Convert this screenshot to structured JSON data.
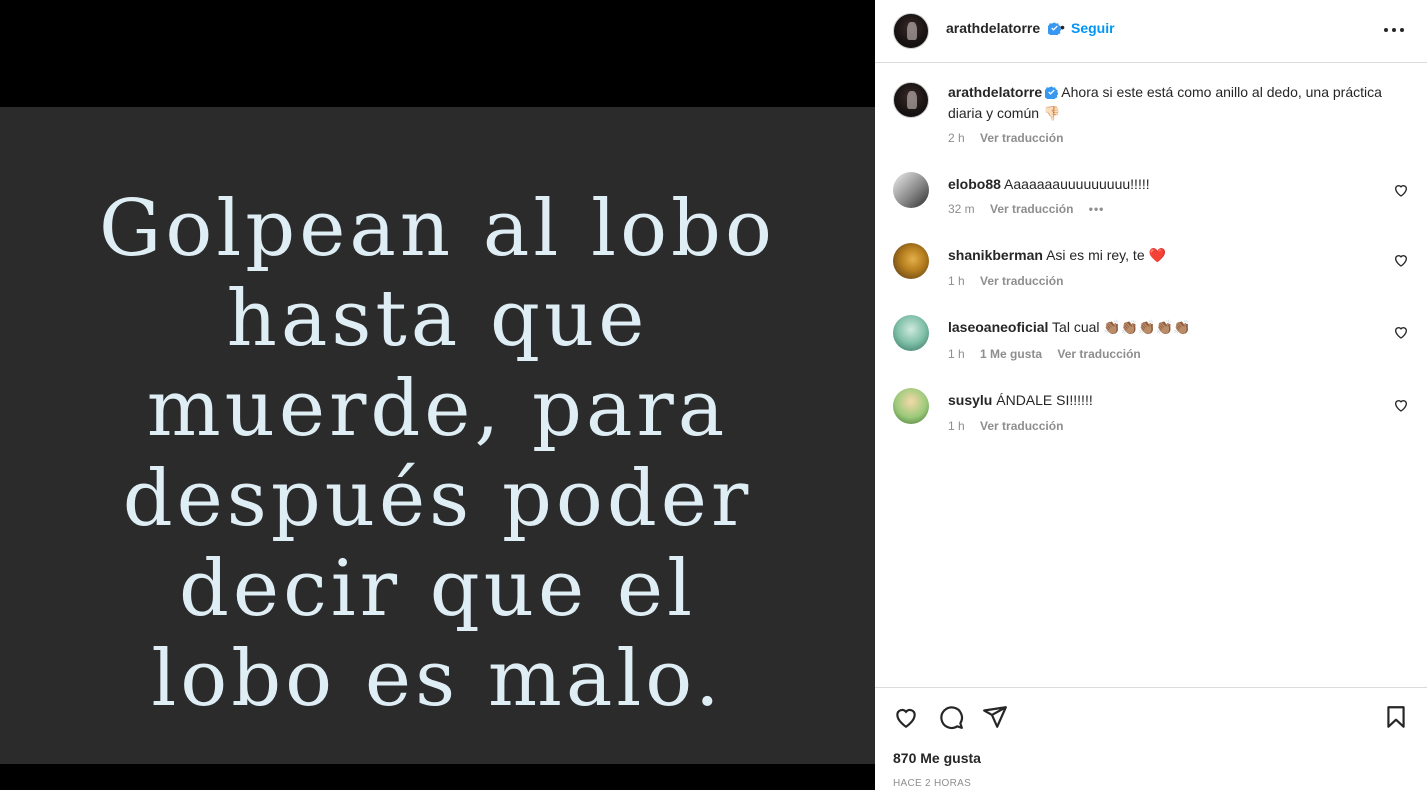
{
  "post": {
    "quote_text": "Golpean al lobo\nhasta que\nmuerde, para\ndespués poder\ndecir que el\nlobo es malo."
  },
  "header": {
    "username": "arathdelatorre",
    "dot": "•",
    "follow_label": "Seguir"
  },
  "caption": {
    "username": "arathdelatorre",
    "text": "Ahora si este está como anillo al dedo, una práctica diaria y común",
    "emoji": "👎🏻",
    "time": "2 h",
    "translate": "Ver traducción"
  },
  "comments": [
    {
      "username": "elobo88",
      "text": "Aaaaaaauuuuuuuuu!!!!!",
      "time": "32 m",
      "likes": "",
      "translate": "Ver traducción",
      "more": "•••"
    },
    {
      "username": "shanikberman",
      "text": "Asi es mi rey, te",
      "emoji": "❤️",
      "time": "1 h",
      "likes": "",
      "translate": "Ver traducción"
    },
    {
      "username": "laseoaneoficial",
      "text": "Tal cual",
      "emoji": "👏🏽👏🏽👏🏽👏🏽👏🏽",
      "time": "1 h",
      "likes": "1 Me gusta",
      "translate": "Ver traducción"
    },
    {
      "username": "susylu",
      "text": "ÁNDALE SI!!!!!!",
      "time": "1 h",
      "likes": "",
      "translate": "Ver traducción"
    }
  ],
  "footer": {
    "likes": "870 Me gusta",
    "timestamp": "HACE 2 HORAS"
  },
  "colors": {
    "accent": "#0095f6",
    "verified": "#3897f0",
    "muted": "#8e8e8e"
  },
  "icons": [
    "verified-badge-icon",
    "more-options-icon",
    "heart-icon",
    "comment-icon",
    "share-icon",
    "bookmark-icon"
  ]
}
